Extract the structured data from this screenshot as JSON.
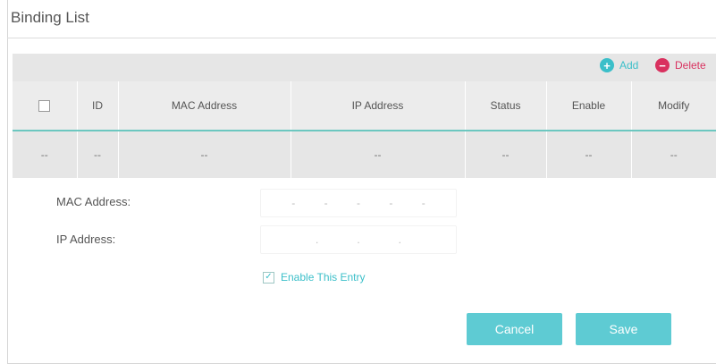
{
  "section": {
    "title": "Binding List"
  },
  "toolbar": {
    "add_label": "Add",
    "delete_label": "Delete",
    "add_color": "#3bbfc9",
    "delete_color": "#d9315f"
  },
  "table": {
    "headers": [
      "ID",
      "MAC Address",
      "IP Address",
      "Status",
      "Enable",
      "Modify"
    ],
    "rows": [
      [
        "--",
        "--",
        "--",
        "--",
        "--",
        "--",
        "--"
      ]
    ]
  },
  "form": {
    "mac_label": "MAC Address:",
    "ip_label": "IP Address:",
    "mac_separators": [
      "-",
      "-",
      "-",
      "-",
      "-"
    ],
    "ip_separators": [
      ".",
      ".",
      "."
    ],
    "enable_label": "Enable This Entry",
    "enable_checked": true
  },
  "buttons": {
    "cancel_label": "Cancel",
    "save_label": "Save",
    "accent_color": "#5ecbd3"
  }
}
